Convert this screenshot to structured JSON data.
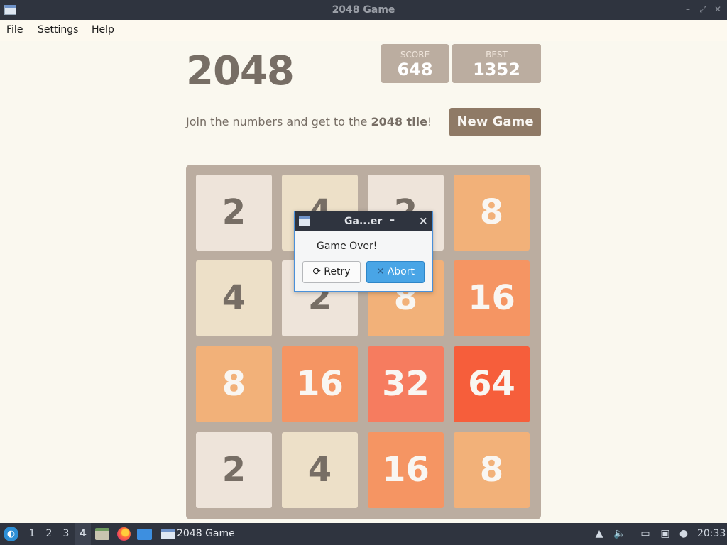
{
  "window": {
    "title": "2048 Game"
  },
  "menu": [
    "File",
    "Settings",
    "Help"
  ],
  "game": {
    "title": "2048",
    "score_label": "SCORE",
    "score_value": "648",
    "best_label": "BEST",
    "best_value": "1352",
    "intro_text": "Join the numbers and get to the ",
    "intro_bold": "2048 tile",
    "intro_end": "!",
    "new_game_label": "New Game",
    "board": [
      [
        2,
        4,
        2,
        8
      ],
      [
        4,
        2,
        8,
        16
      ],
      [
        8,
        16,
        32,
        64
      ],
      [
        2,
        4,
        16,
        8
      ]
    ]
  },
  "dialog": {
    "title": "Ga...er",
    "message": "Game Over!",
    "retry_label": "Retry",
    "abort_label": "Abort",
    "minimize_glyph": "–",
    "close_glyph": "×"
  },
  "taskbar": {
    "workspaces": [
      "1",
      "2",
      "3",
      "4"
    ],
    "active_workspace": "4",
    "task_label": "2048 Game",
    "clock": "20:33"
  },
  "colors": {
    "tile_2": "#eee4da",
    "tile_4": "#ede0c8",
    "tile_8": "#f2b179",
    "tile_16": "#f59563",
    "tile_32": "#f67c5f",
    "tile_64": "#f65e3b",
    "board": "#bbada0",
    "new_game_button": "#8f7a66",
    "abort_button": "#49a5e6"
  }
}
